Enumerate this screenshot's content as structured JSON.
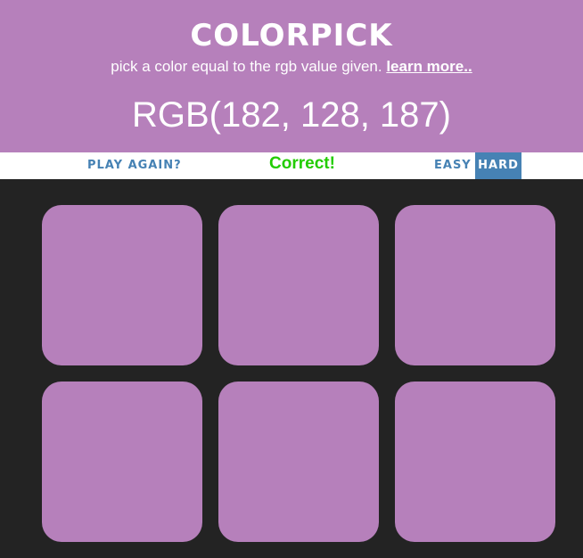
{
  "header": {
    "title": "colorpick",
    "subtitle": "pick a color equal to the rgb value given.",
    "learn_more": "learn more..",
    "rgb_display": "RGB(182, 128, 187)"
  },
  "controls": {
    "play_again": "play again?",
    "message": "Correct!",
    "easy": "easy",
    "hard": "hard",
    "selected_mode": "hard"
  },
  "squares": [
    "#b680bb",
    "#b680bb",
    "#b680bb",
    "#b680bb",
    "#b680bb",
    "#b680bb"
  ],
  "colors": {
    "header_bg": "#b680bb",
    "board_bg": "#232323",
    "button_text": "#4682b4",
    "selected_button_bg": "#4682b4",
    "message_color": "#22cc00"
  }
}
